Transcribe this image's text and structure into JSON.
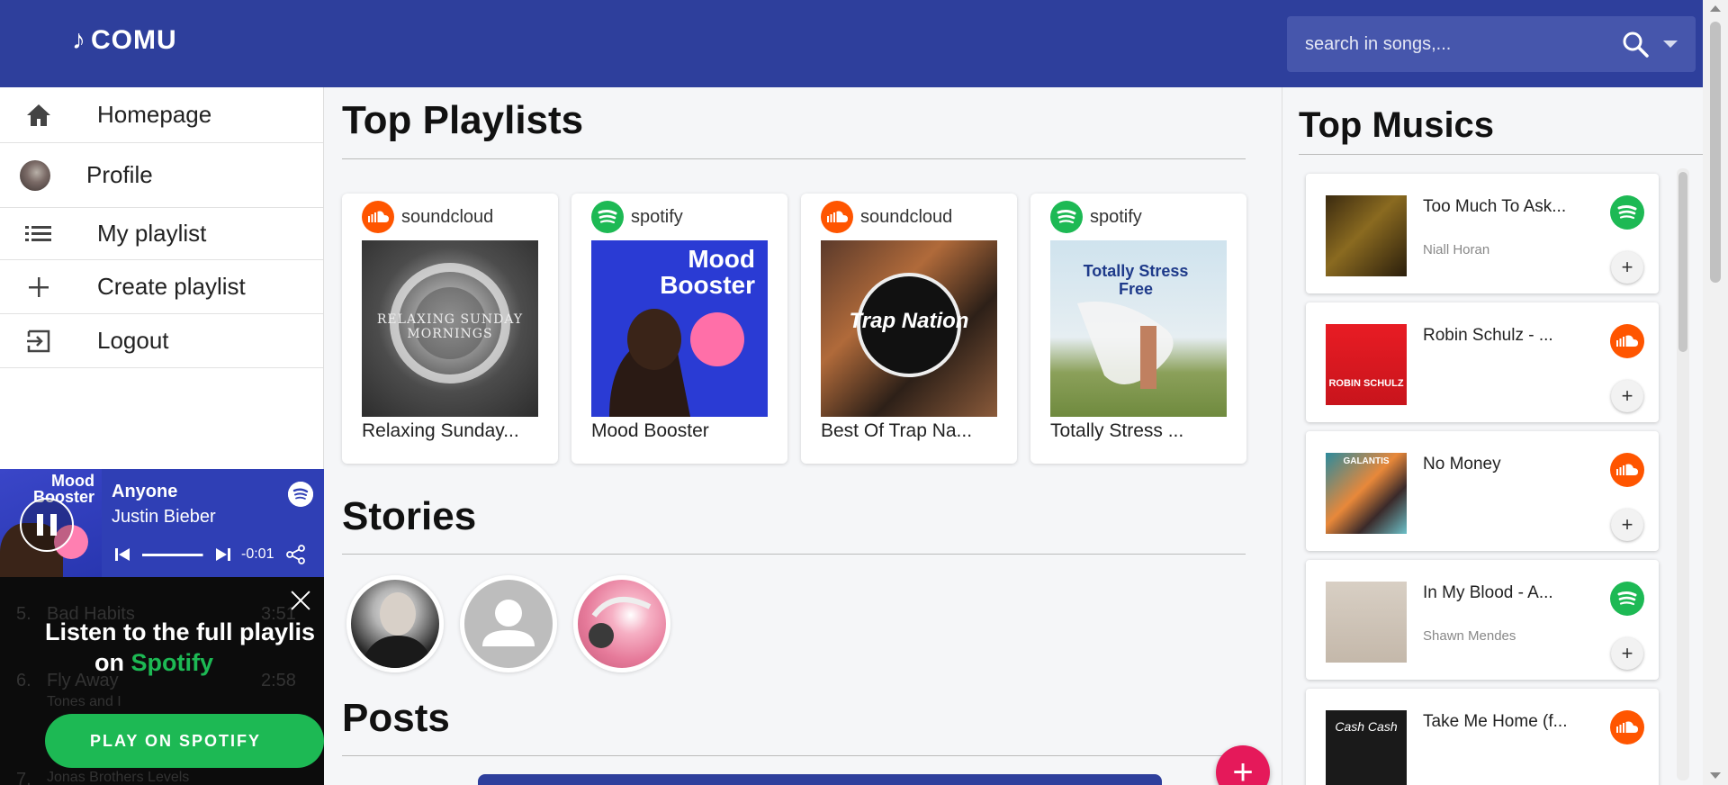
{
  "header": {
    "logo_text": "COMU",
    "search_placeholder": "search in songs,..."
  },
  "sidebar": {
    "items": [
      {
        "label": "Homepage",
        "icon": "home-icon"
      },
      {
        "label": "Profile",
        "icon": "avatar"
      },
      {
        "label": "My playlist",
        "icon": "list-icon"
      },
      {
        "label": "Create playlist",
        "icon": "plus-icon"
      },
      {
        "label": "Logout",
        "icon": "logout-icon"
      }
    ]
  },
  "player": {
    "cover_text": "Mood Booster",
    "track": "Anyone",
    "artist": "Justin Bieber",
    "time": "-0:01",
    "progress": 0.98
  },
  "spotify_overlay": {
    "line1": "Listen to the full playlis",
    "line2_prefix": "on",
    "line2_brand": "Spotify",
    "button_label": "PLAY ON SPOTIFY",
    "ghost_rows": [
      {
        "num": "5.",
        "title": "Bad Habits",
        "time": "3:51"
      },
      {
        "num": "6.",
        "title": "Fly Away",
        "sub": "Tones and I",
        "time": "2:58"
      },
      {
        "num": "7.",
        "title": "Jonas Brothers Levels"
      }
    ]
  },
  "main": {
    "top_playlists_title": "Top Playlists",
    "playlists": [
      {
        "source": "soundcloud",
        "title": "Relaxing Sunday...",
        "art_text": "RELAXING SUNDAY MORNINGS"
      },
      {
        "source": "spotify",
        "title": "Mood Booster",
        "art_text": "Mood Booster"
      },
      {
        "source": "soundcloud",
        "title": "Best Of Trap Na...",
        "art_text": "Trap Nation"
      },
      {
        "source": "spotify",
        "title": "Totally Stress ...",
        "art_text": "Totally Stress Free"
      }
    ],
    "stories_title": "Stories",
    "posts_title": "Posts",
    "fab_label": "+"
  },
  "right": {
    "title": "Top Musics",
    "musics": [
      {
        "title": "Too Much To Ask...",
        "artist": "Niall Horan",
        "source": "spotify"
      },
      {
        "title": "Robin Schulz - ...",
        "artist": "",
        "source": "soundcloud",
        "thumb_text": "ROBIN SCHULZ"
      },
      {
        "title": "No Money",
        "artist": "",
        "source": "soundcloud",
        "thumb_text": "GALANTIS"
      },
      {
        "title": "In My Blood - A...",
        "artist": "Shawn Mendes",
        "source": "spotify"
      },
      {
        "title": "Take Me Home (f...",
        "artist": "",
        "source": "soundcloud",
        "thumb_text": "Cash Cash"
      }
    ],
    "add_label": "+"
  },
  "colors": {
    "header": "#2e3f9c",
    "spotify_green": "#1db954",
    "soundcloud_orange": "#ff5500",
    "fab": "#e5195a",
    "player": "#2f3fb5"
  }
}
